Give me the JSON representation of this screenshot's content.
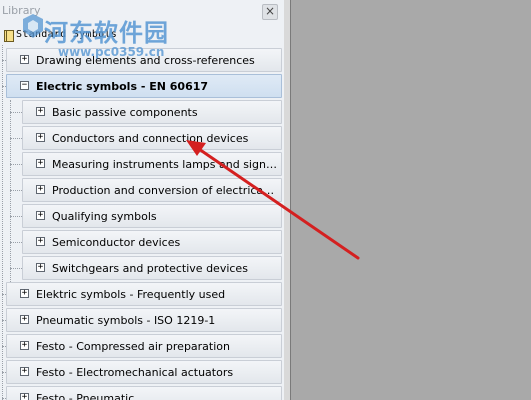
{
  "panel": {
    "title": "Library",
    "close_glyph": "×",
    "root_label": "Standard Symbols"
  },
  "tree": [
    {
      "label": "Drawing elements and cross-references",
      "toggle": "+",
      "level": 1
    },
    {
      "label": "Electric symbols - EN 60617",
      "toggle": "−",
      "level": 1,
      "selected": true
    },
    {
      "label": "Basic passive components",
      "toggle": "+",
      "level": 2
    },
    {
      "label": "Conductors and connection devices",
      "toggle": "+",
      "level": 2
    },
    {
      "label": "Measuring instruments lamps and signalling devices",
      "toggle": "+",
      "level": 2
    },
    {
      "label": "Production and conversion of electrical energy",
      "toggle": "+",
      "level": 2
    },
    {
      "label": "Qualifying symbols",
      "toggle": "+",
      "level": 2
    },
    {
      "label": "Semiconductor devices",
      "toggle": "+",
      "level": 2
    },
    {
      "label": "Switchgears and protective devices",
      "toggle": "+",
      "level": 2
    },
    {
      "label": "Elektric symbols - Frequently used",
      "toggle": "+",
      "level": 1
    },
    {
      "label": "Pneumatic symbols - ISO 1219-1",
      "toggle": "+",
      "level": 1
    },
    {
      "label": "Festo - Compressed air preparation",
      "toggle": "+",
      "level": 1
    },
    {
      "label": "Festo - Electromechanical actuators",
      "toggle": "+",
      "level": 1
    },
    {
      "label": "Festo - Pneumatic",
      "toggle": "+",
      "level": 1
    }
  ],
  "watermark": {
    "text": "河东软件园",
    "url": "www.pc0359.cn"
  },
  "colors": {
    "arrow": "#d42020",
    "watermark": "#5696d2",
    "selected_row": "#cfdff0"
  }
}
